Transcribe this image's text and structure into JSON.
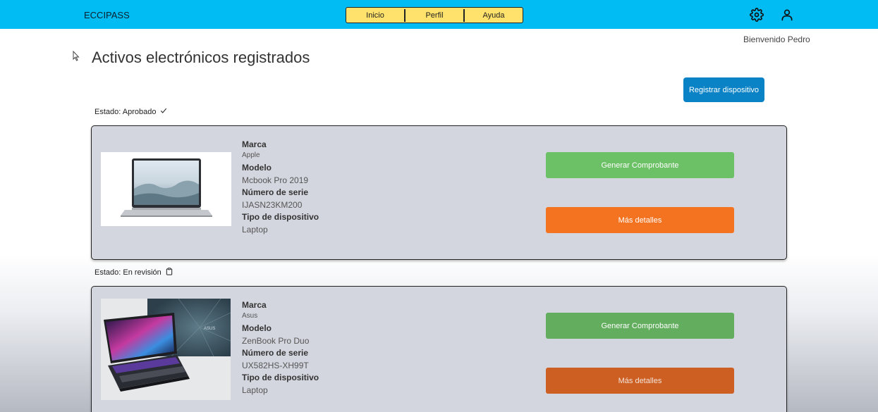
{
  "header": {
    "brand": "ECCIPASS",
    "nav": [
      "Inicio",
      "Perfil",
      "Ayuda"
    ],
    "settings_icon": "gear-icon",
    "user_icon": "user-icon"
  },
  "welcome": "Bienvenido Pedro",
  "page_title": "Activos electrónicos registrados",
  "register_button": "Registrar dispositivo",
  "colors": {
    "topbar": "#00bcf2",
    "nav_bg": "#ffe26b",
    "primary": "#0a82c6",
    "green": "#6cc066",
    "orange": "#f47321",
    "card_bg": "#d3d6de"
  },
  "devices": [
    {
      "status_label": "Estado: Aprobado",
      "status_icon": "check-icon",
      "brand_label": "Marca",
      "brand": "Apple",
      "model_label": "Modelo",
      "model": "Mcbook Pro 2019",
      "serial_label": "Número de serie",
      "serial": "IJASN23KM200",
      "type_label": "Tipo de dispositivo",
      "type": "Laptop",
      "receipt_button": "Generar Comprobante",
      "details_button": "Más detalles"
    },
    {
      "status_label": "Estado: En revisión",
      "status_icon": "clipboard-icon",
      "brand_label": "Marca",
      "brand": "Asus",
      "model_label": "Modelo",
      "model": "ZenBook Pro Duo",
      "serial_label": "Número de serie",
      "serial": "UX582HS-XH99T",
      "type_label": "Tipo de dispositivo",
      "type": "Laptop",
      "receipt_button": "Generar Comprobante",
      "details_button": "Más detalles"
    }
  ]
}
